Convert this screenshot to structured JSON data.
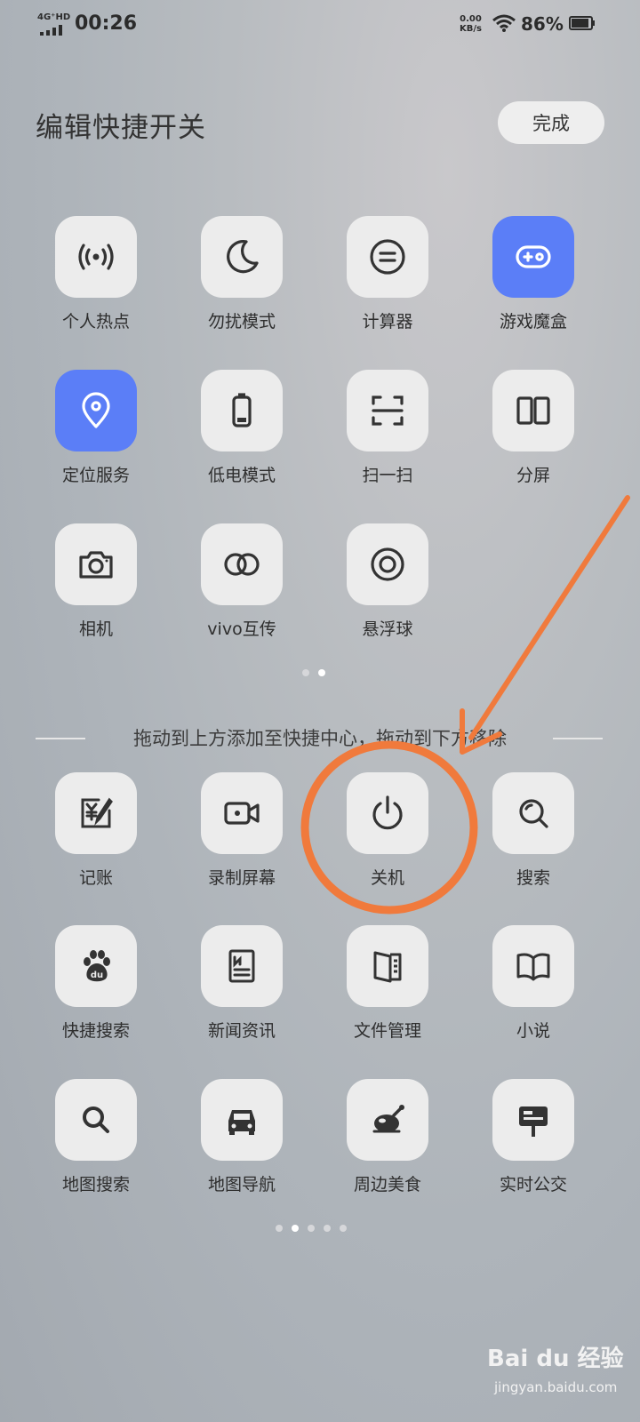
{
  "status": {
    "network": "4G⁺HD",
    "time": "00:26",
    "speed_top": "0.00",
    "speed_unit": "KB/s",
    "battery": "86%"
  },
  "header": {
    "title": "编辑快捷开关",
    "done_label": "完成"
  },
  "active_tiles": [
    {
      "label": "个人热点",
      "icon": "hotspot-icon",
      "active": false
    },
    {
      "label": "勿扰模式",
      "icon": "moon-icon",
      "active": false
    },
    {
      "label": "计算器",
      "icon": "calculator-icon",
      "active": false
    },
    {
      "label": "游戏魔盒",
      "icon": "gamepad-icon",
      "active": true
    },
    {
      "label": "定位服务",
      "icon": "location-icon",
      "active": true
    },
    {
      "label": "低电模式",
      "icon": "battery-icon",
      "active": false
    },
    {
      "label": "扫一扫",
      "icon": "scan-icon",
      "active": false
    },
    {
      "label": "分屏",
      "icon": "split-screen-icon",
      "active": false
    },
    {
      "label": "相机",
      "icon": "camera-icon",
      "active": false
    },
    {
      "label": "vivo互传",
      "icon": "share-link-icon",
      "active": false
    },
    {
      "label": "悬浮球",
      "icon": "floating-ball-icon",
      "active": false
    }
  ],
  "hint": "拖动到上方添加至快捷中心，拖动到下方移除",
  "available_tiles": [
    {
      "label": "记账",
      "icon": "bookkeeping-icon"
    },
    {
      "label": "录制屏幕",
      "icon": "screen-record-icon"
    },
    {
      "label": "关机",
      "icon": "power-icon"
    },
    {
      "label": "搜索",
      "icon": "search-icon"
    },
    {
      "label": "快捷搜索",
      "icon": "paw-icon"
    },
    {
      "label": "新闻资讯",
      "icon": "news-icon"
    },
    {
      "label": "文件管理",
      "icon": "folder-icon"
    },
    {
      "label": "小说",
      "icon": "book-icon"
    },
    {
      "label": "地图搜索",
      "icon": "map-search-icon"
    },
    {
      "label": "地图导航",
      "icon": "car-icon"
    },
    {
      "label": "周边美食",
      "icon": "food-icon"
    },
    {
      "label": "实时公交",
      "icon": "bus-stop-icon"
    }
  ],
  "page_indicator_top": {
    "count": 2,
    "current": 1
  },
  "page_indicator_bottom": {
    "count": 5,
    "current": 1
  },
  "watermark": {
    "brand": "Bai du 经验",
    "url": "jingyan.baidu.com"
  },
  "colors": {
    "accent": "#5b7ef7",
    "annotation": "#f07a3c",
    "tile_bg": "#ececec"
  }
}
